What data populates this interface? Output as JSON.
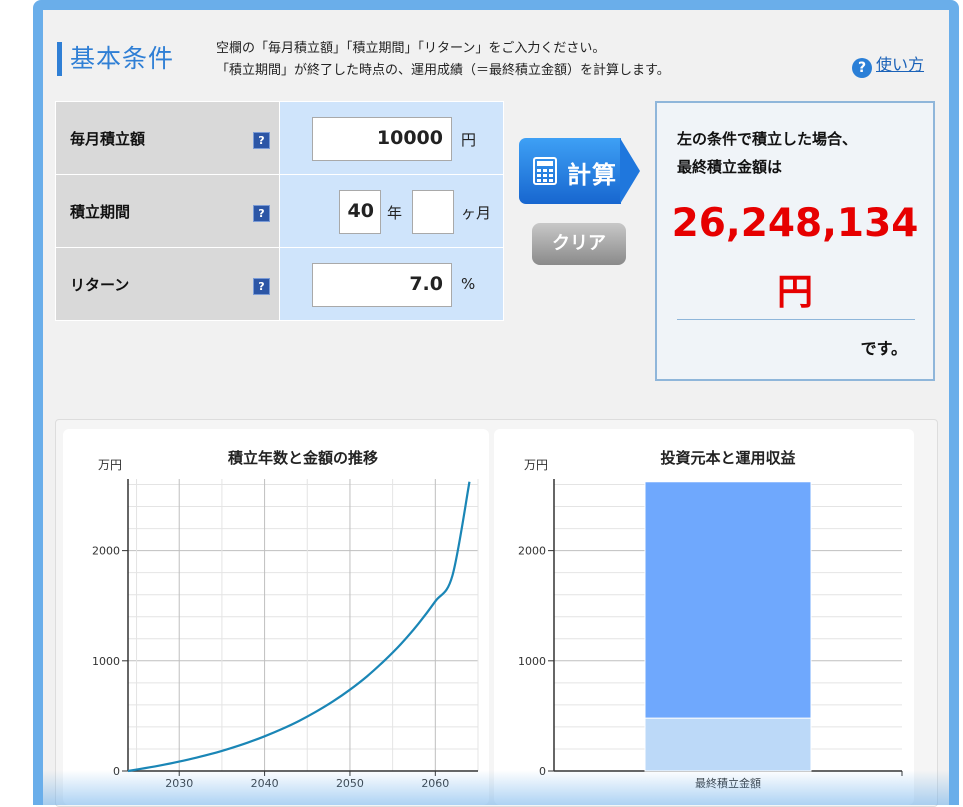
{
  "header": {
    "title": "基本条件",
    "desc_line1": "空欄の「毎月積立額」「積立期間」「リターン」をご入力ください。",
    "desc_line2": "「積立期間」が終了した時点の、運用成績（＝最終積立金額）を計算します。",
    "howto_label": "使い方",
    "howto_icon": "question-circle-icon"
  },
  "form": {
    "monthly": {
      "label": "毎月積立額",
      "value": "10000",
      "unit": "円"
    },
    "period": {
      "label": "積立期間",
      "years": "40",
      "years_unit": "年",
      "months": "",
      "months_unit": "ヶ月"
    },
    "return": {
      "label": "リターン",
      "value": "7.0",
      "unit": "%"
    },
    "help_glyph": "?"
  },
  "buttons": {
    "calc_label": "計算",
    "calc_icon": "calculator-icon",
    "clear_label": "クリア"
  },
  "result": {
    "line1": "左の条件で積立した場合、",
    "line2": "最終積立金額は",
    "amount": "26,248,134",
    "currency": "円",
    "tail": "です。"
  },
  "colors": {
    "accent": "#2f7fd5",
    "result_red": "#e60000",
    "line": "#1a86b6",
    "bar_profit": "#6fa8fd",
    "bar_principal": "#bcd9f8"
  },
  "chart_data": [
    {
      "type": "line",
      "title": "積立年数と金額の推移",
      "ylabel": "万円",
      "x": [
        2024,
        2026,
        2028,
        2030,
        2032,
        2034,
        2036,
        2038,
        2040,
        2042,
        2044,
        2046,
        2048,
        2050,
        2052,
        2054,
        2056,
        2058,
        2060,
        2062,
        2064
      ],
      "series": [
        {
          "values": [
            0,
            26,
            54,
            86,
            121,
            160,
            206,
            257,
            315,
            380,
            453,
            537,
            631,
            738,
            859,
            999,
            1155,
            1335,
            1540,
            1772,
            2625
          ]
        }
      ],
      "xticks": [
        "2030",
        "2040",
        "2050",
        "2060"
      ],
      "yticks": [
        "0",
        "1000",
        "2000"
      ],
      "xlim": [
        2024,
        2065
      ],
      "ylim": [
        0,
        2650
      ],
      "grid": true
    },
    {
      "type": "bar",
      "title": "投資元本と運用収益",
      "ylabel": "万円",
      "categories": [
        "最終積立金額"
      ],
      "series": [
        {
          "values": [
            480
          ]
        },
        {
          "values": [
            2145
          ]
        }
      ],
      "yticks": [
        "0",
        "1000",
        "2000"
      ],
      "ylim": [
        0,
        2650
      ],
      "stacked": true,
      "grid": true
    }
  ]
}
